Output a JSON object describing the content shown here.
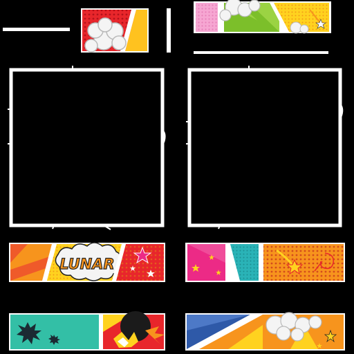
{
  "sheet": {
    "title_text": "LUNAR",
    "colors": {
      "background": "#000000",
      "frame": "#ffffff",
      "red": "#e8262b",
      "orange": "#f7941d",
      "yellow": "#ffd21f",
      "pink": "#ec2a86",
      "teal": "#2ab3b7",
      "green_light": "#9bd343",
      "blue": "#2e59a8",
      "mint": "#33bfa6",
      "cloud": "#f4f4f4",
      "lavender": "#f6a6d2"
    },
    "icons": [
      "cloud-burst-icon",
      "star-icon",
      "comet-icon",
      "explosion-icon",
      "splat-icon"
    ]
  }
}
